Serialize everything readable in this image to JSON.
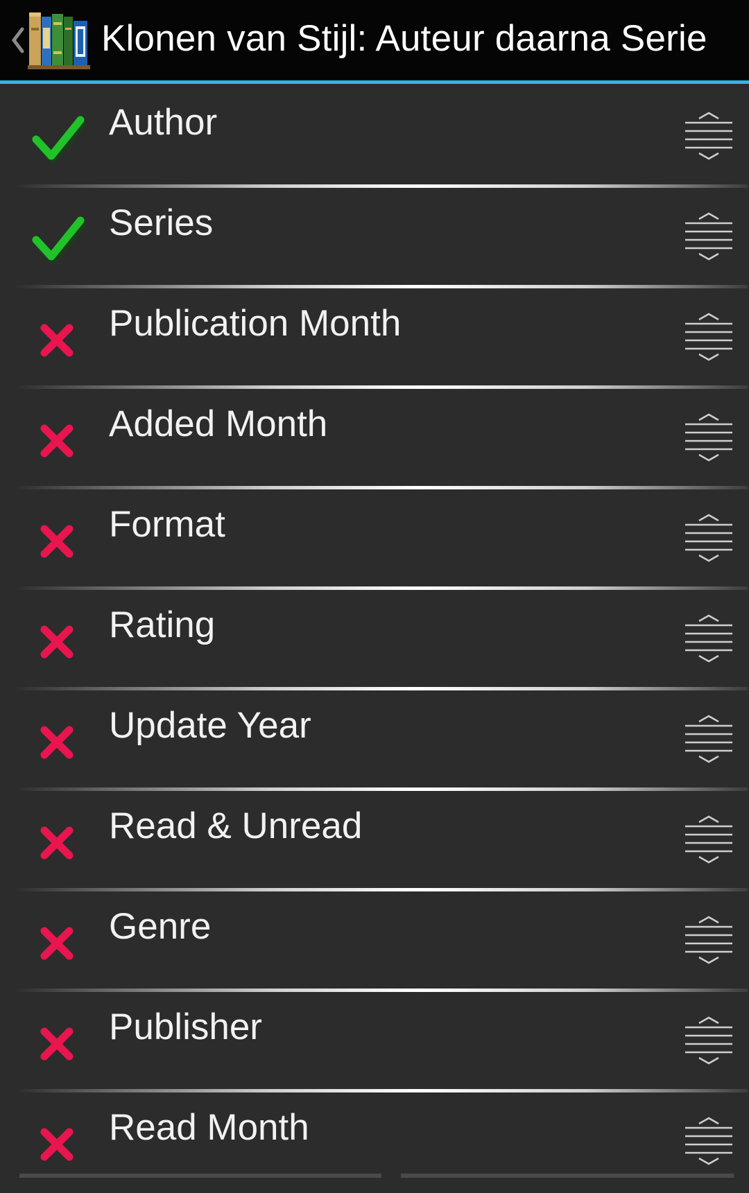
{
  "header": {
    "title": "Klonen van Stijl: Auteur daarna Serie",
    "back_icon": "chevron-left-icon",
    "app_icon": "books-icon",
    "accent_color": "#33b5e5"
  },
  "colors": {
    "enabled": "#22c22a",
    "disabled": "#e8154f",
    "background": "#2c2c2c"
  },
  "items": [
    {
      "label": "Author",
      "enabled": true,
      "status_icon": "checkmark-icon"
    },
    {
      "label": "Series",
      "enabled": true,
      "status_icon": "checkmark-icon"
    },
    {
      "label": "Publication Month",
      "enabled": false,
      "status_icon": "cross-icon"
    },
    {
      "label": "Added Month",
      "enabled": false,
      "status_icon": "cross-icon"
    },
    {
      "label": "Format",
      "enabled": false,
      "status_icon": "cross-icon"
    },
    {
      "label": "Rating",
      "enabled": false,
      "status_icon": "cross-icon"
    },
    {
      "label": "Update Year",
      "enabled": false,
      "status_icon": "cross-icon"
    },
    {
      "label": "Read & Unread",
      "enabled": false,
      "status_icon": "cross-icon"
    },
    {
      "label": "Genre",
      "enabled": false,
      "status_icon": "cross-icon"
    },
    {
      "label": "Publisher",
      "enabled": false,
      "status_icon": "cross-icon"
    },
    {
      "label": "Read Month",
      "enabled": false,
      "status_icon": "cross-icon"
    }
  ]
}
